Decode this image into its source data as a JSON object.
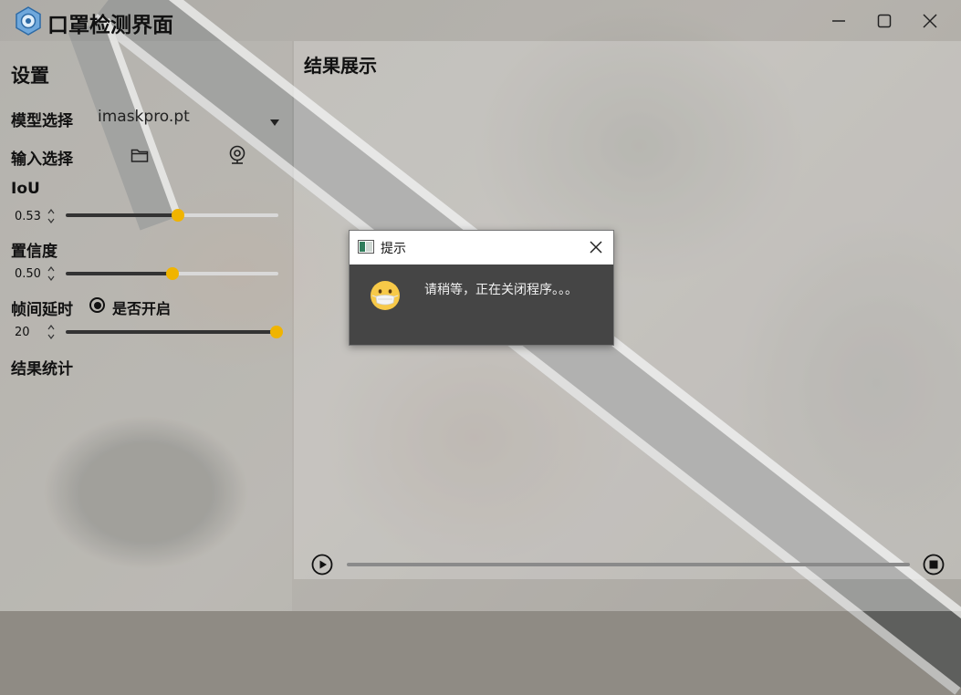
{
  "window": {
    "title": "口罩检测界面",
    "controls": [
      "minimize",
      "maximize",
      "close"
    ]
  },
  "settings": {
    "heading": "设置",
    "model_label": "模型选择",
    "model_value": "imaskpro.pt",
    "input_label": "输入选择",
    "iou_label": "IoU",
    "iou_value": "0.53",
    "iou_fraction": 0.53,
    "confidence_label": "置信度",
    "confidence_value": "0.50",
    "confidence_fraction": 0.5,
    "frame_delay_label": "帧间延时",
    "frame_delay_toggle_label": "是否开启",
    "frame_delay_enabled": true,
    "frame_delay_value": "20",
    "frame_delay_fraction": 1.0,
    "stats_label": "结果统计"
  },
  "results": {
    "heading": "结果展示",
    "progress_fraction": 0
  },
  "dialog": {
    "title": "提示",
    "message": "请稍等，正在关闭程序。。。",
    "icon": "mask-face-emoji"
  },
  "colors": {
    "accent": "#f0b400",
    "dialog_body": "#454545"
  }
}
